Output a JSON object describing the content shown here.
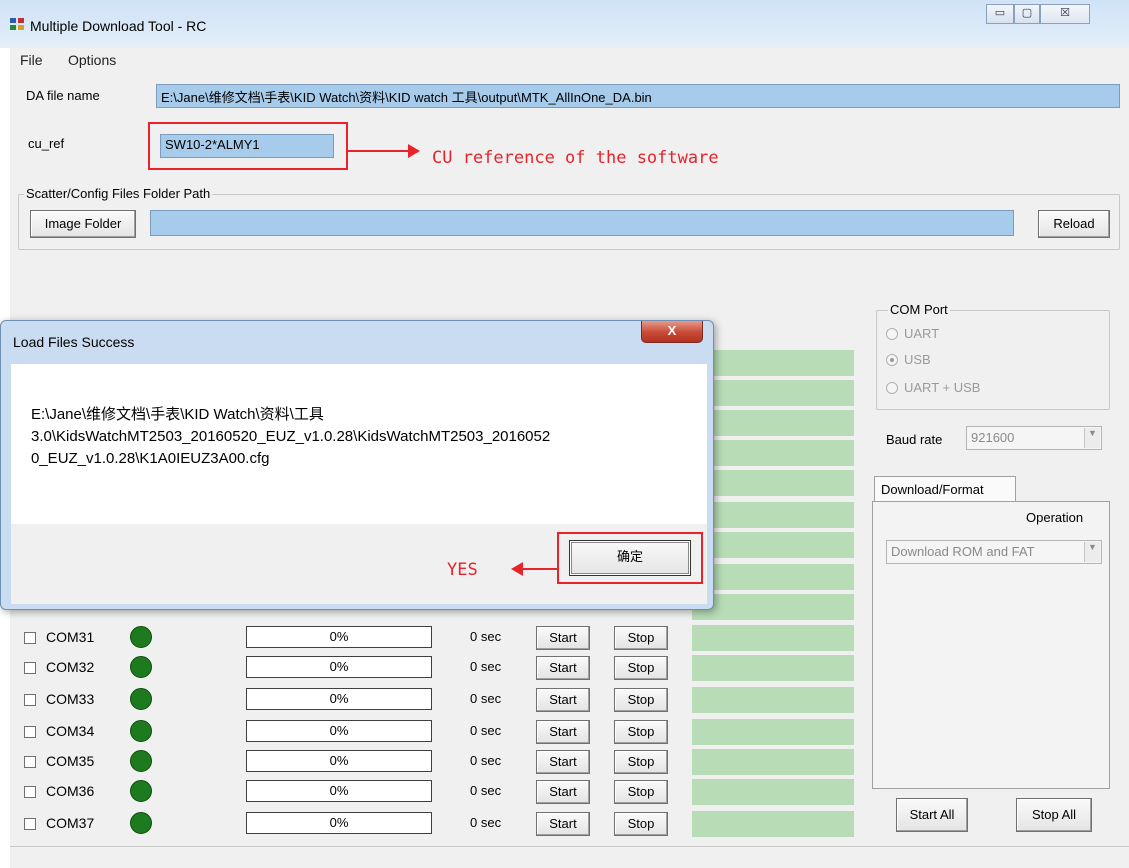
{
  "window": {
    "title": "Multiple Download Tool - RC",
    "minimize": "▭",
    "maximize": "▢",
    "close": "☒"
  },
  "menu": {
    "file": "File",
    "options": "Options"
  },
  "da": {
    "label": "DA file name",
    "value": "E:\\Jane\\维修文档\\手表\\KID Watch\\资料\\KID watch 工具\\output\\MTK_AllInOne_DA.bin"
  },
  "cu_ref": {
    "label": "cu_ref",
    "value": "SW10-2*ALMY1"
  },
  "scatter": {
    "group_label": "Scatter/Config Files Folder Path",
    "image_folder": "Image Folder",
    "reload": "Reload",
    "path": ""
  },
  "annotations": {
    "cu_note": "CU reference of the software",
    "yes_note": "YES"
  },
  "com_port": {
    "title": "COM Port",
    "options": [
      "UART",
      "USB",
      "UART + USB"
    ],
    "selected": "USB"
  },
  "baud": {
    "label": "Baud rate",
    "value": "921600"
  },
  "tabs": {
    "download_format": "Download/Format"
  },
  "operation": {
    "label": "Operation",
    "value": "Download ROM and FAT"
  },
  "buttons": {
    "start_all": "Start All",
    "stop_all": "Stop All",
    "start": "Start",
    "stop": "Stop"
  },
  "ports": [
    {
      "name": "COM31",
      "progress": "0%",
      "time": "0 sec"
    },
    {
      "name": "COM32",
      "progress": "0%",
      "time": "0 sec"
    },
    {
      "name": "COM33",
      "progress": "0%",
      "time": "0 sec"
    },
    {
      "name": "COM34",
      "progress": "0%",
      "time": "0 sec"
    },
    {
      "name": "COM35",
      "progress": "0%",
      "time": "0 sec"
    },
    {
      "name": "COM36",
      "progress": "0%",
      "time": "0 sec"
    },
    {
      "name": "COM37",
      "progress": "0%",
      "time": "0 sec"
    }
  ],
  "dialog": {
    "title": "Load Files Success",
    "close": "X",
    "message_lines": [
      "E:\\Jane\\维修文档\\手表\\KID Watch\\资料\\工具",
      "3.0\\KidsWatchMT2503_20160520_EUZ_v1.0.28\\KidsWatchMT2503_2016052",
      "0_EUZ_v1.0.28\\K1A0IEUZ3A00.cfg"
    ],
    "ok": "确定"
  },
  "colors": {
    "accent_red": "#e8232a",
    "led_green": "#1e7a1e",
    "field_blue": "#a6cbeb",
    "status_green": "#b7dcb6"
  }
}
